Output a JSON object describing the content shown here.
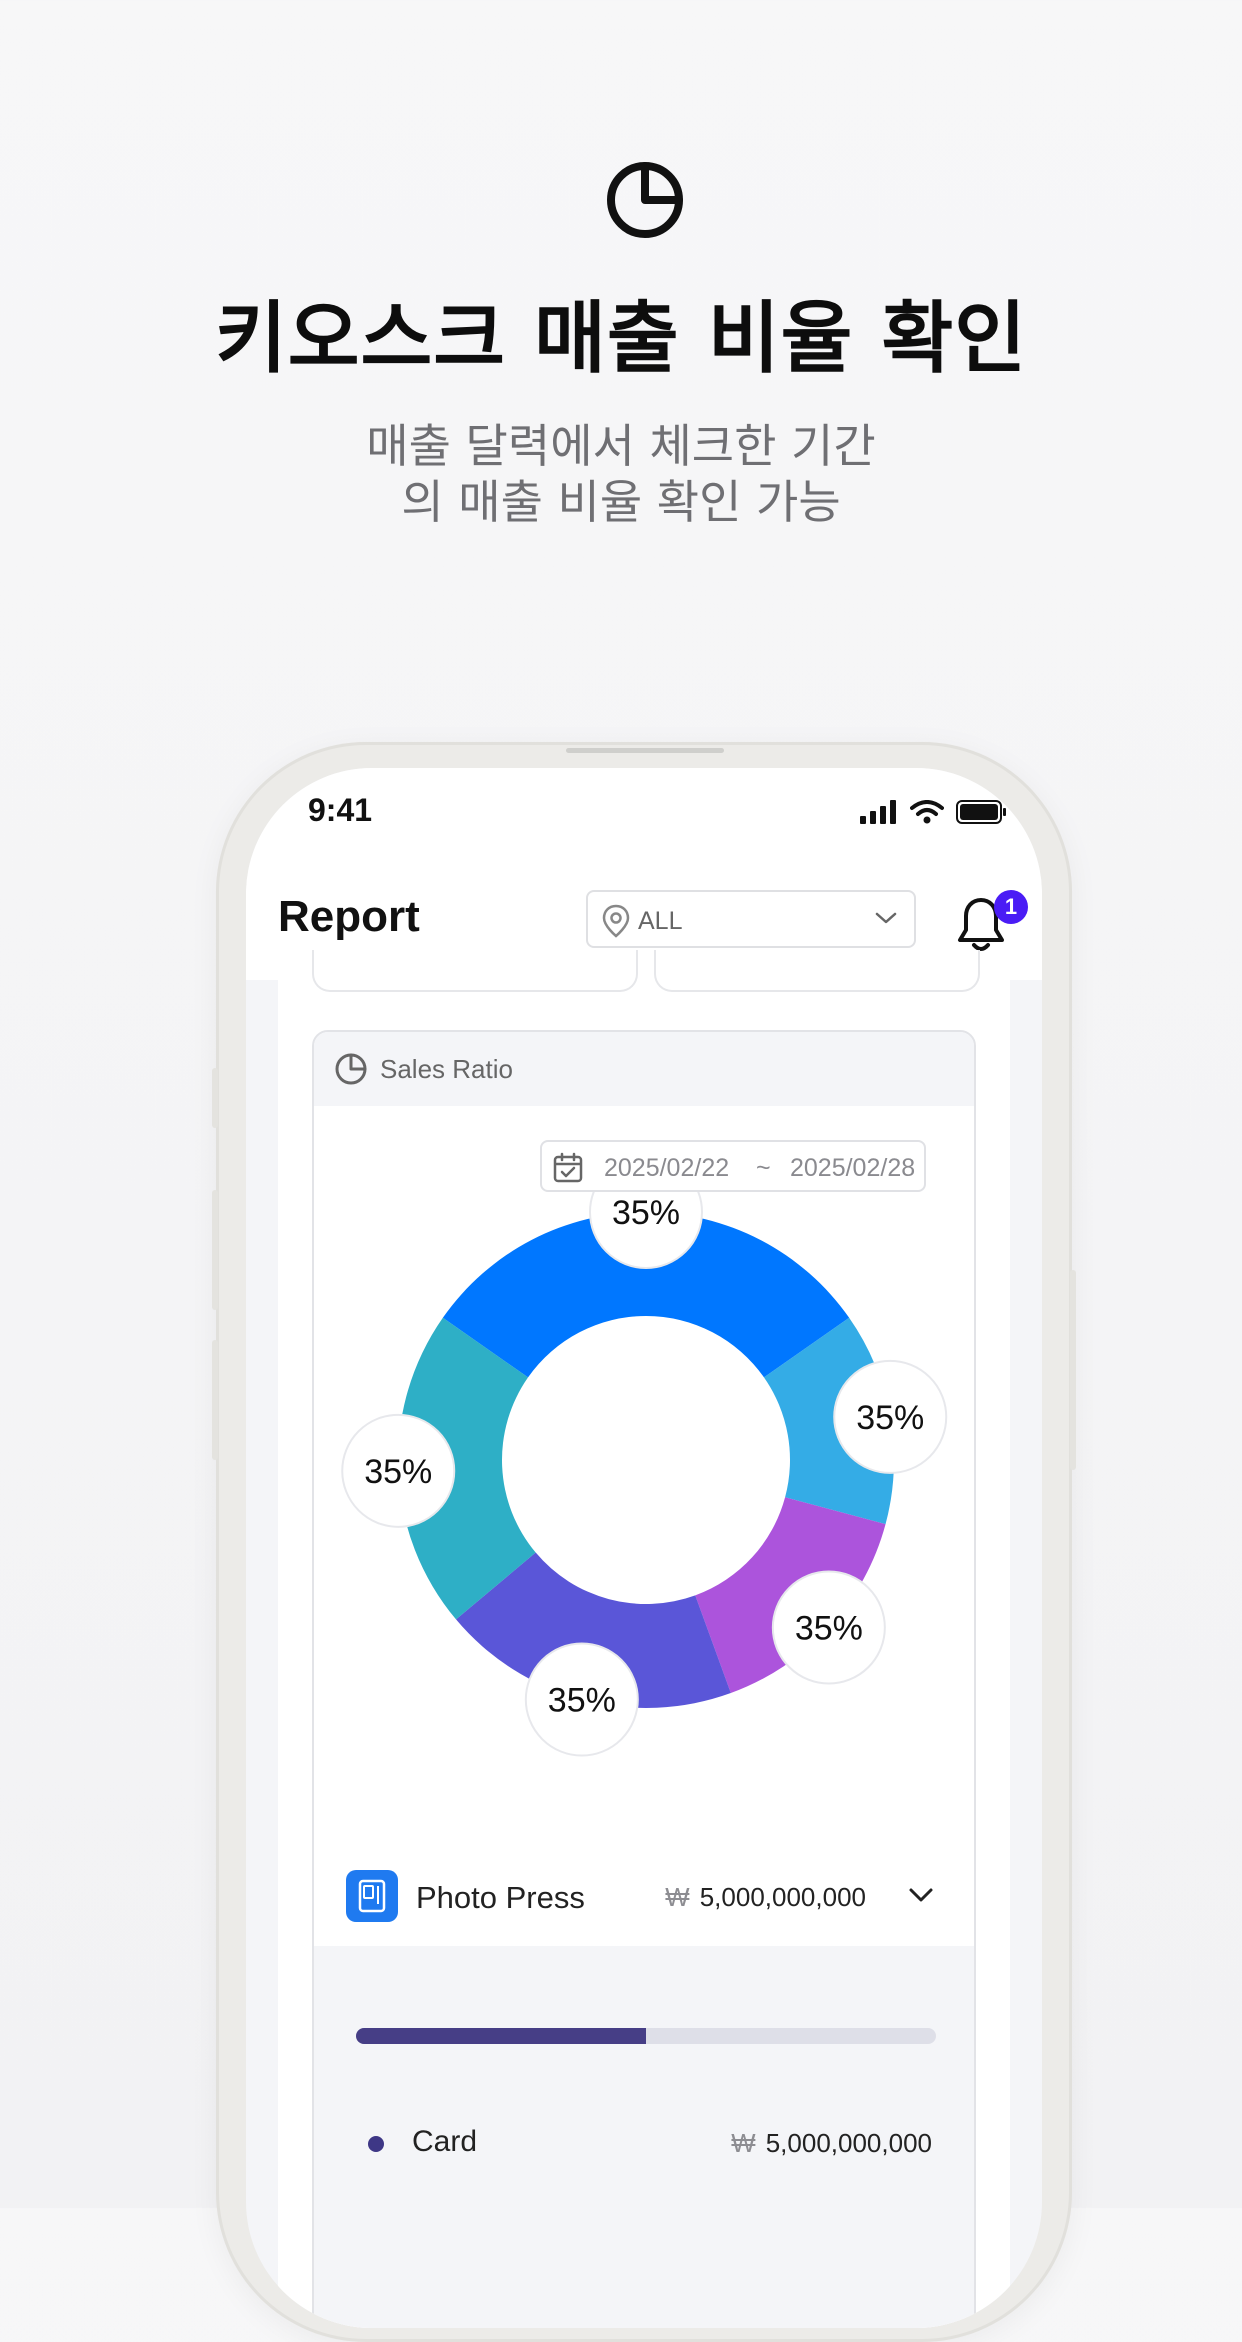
{
  "promo": {
    "title": "키오스크 매출 비율 확인",
    "subtitle_line1": "매출 달력에서 체크한 기간",
    "subtitle_line2": "의 매출 비율 확인 가능"
  },
  "status_bar": {
    "time": "9:41"
  },
  "header": {
    "title": "Report",
    "store_select_value": "ALL",
    "notification_count": "1"
  },
  "sales_ratio": {
    "title": "Sales Ratio",
    "date_start": "2025/02/22",
    "date_separator": "~",
    "date_end": "2025/02/28"
  },
  "chart_data": {
    "type": "pie",
    "variant": "donut",
    "segments": [
      {
        "label": "35%",
        "color": "#0077ff",
        "angle_start": -55,
        "angle_end": 55
      },
      {
        "label": "35%",
        "color": "#34ace6",
        "angle_start": 55,
        "angle_end": 105
      },
      {
        "label": "35%",
        "color": "#ac54dc",
        "angle_start": 105,
        "angle_end": 160
      },
      {
        "label": "35%",
        "color": "#5a56d8",
        "angle_start": 160,
        "angle_end": 230
      },
      {
        "label": "35%",
        "color": "#2eafc6",
        "angle_start": 230,
        "angle_end": 305
      }
    ]
  },
  "kiosk": {
    "name": "Photo Press",
    "currency": "₩",
    "amount": "5,000,000,000"
  },
  "breakdown": {
    "progress": 0.5,
    "items": [
      {
        "label": "Card",
        "currency": "₩",
        "amount": "5,000,000,000",
        "color": "#3e3786"
      }
    ]
  }
}
